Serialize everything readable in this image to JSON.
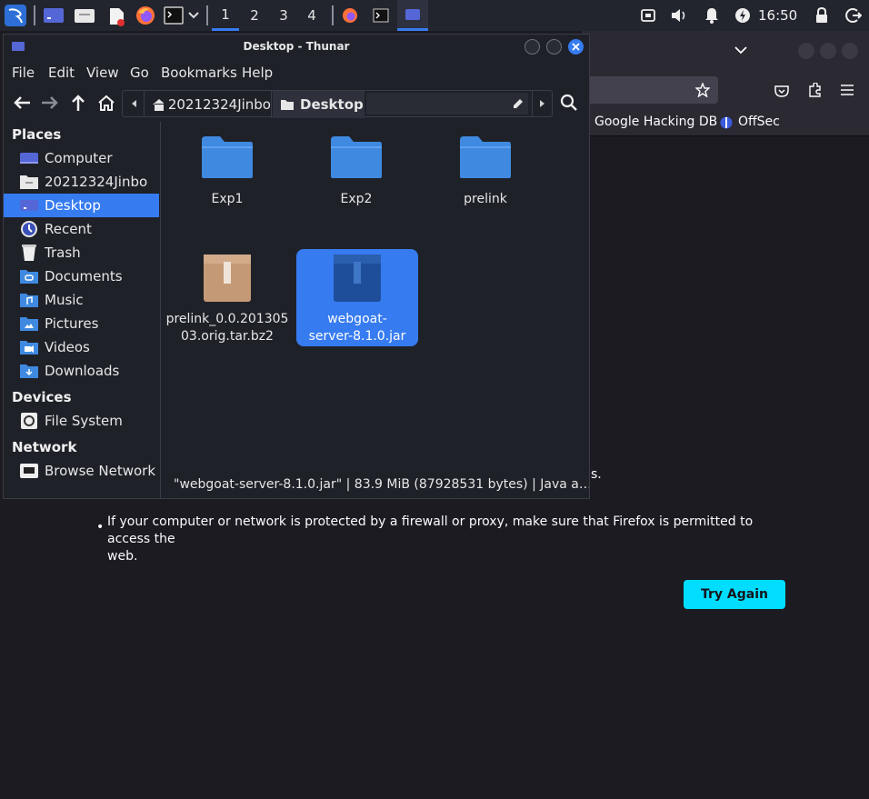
{
  "panel": {
    "workspaces": [
      "1",
      "2",
      "3",
      "4"
    ],
    "clock": "16:50",
    "icons": [
      "kali-menu-icon",
      "desktop-icon",
      "file-manager-icon",
      "text-editor-icon",
      "firefox-icon",
      "terminal-icon",
      "chevron-down-icon",
      "firefox-task-icon",
      "terminal-task-icon",
      "thunar-task-icon",
      "network-icon",
      "volume-icon",
      "notifications-icon",
      "power-icon",
      "lock-icon",
      "logout-icon"
    ]
  },
  "firefox": {
    "bookmarks": [
      "Google Hacking DB",
      "OffSec"
    ],
    "error_lines": [
      "s.",
      "If your computer or network is protected by a firewall or proxy, make sure that Firefox is permitted to access the",
      "web."
    ],
    "try_again_label": "Try Again"
  },
  "thunar": {
    "title": "Desktop - Thunar",
    "menu": [
      "File",
      "Edit",
      "View",
      "Go",
      "Bookmarks",
      "Help"
    ],
    "breadcrumbs": [
      "20212324Jinbo",
      "Desktop"
    ],
    "sidebar": {
      "places_heading": "Places",
      "places": [
        "Computer",
        "20212324Jinbo",
        "Desktop",
        "Recent",
        "Trash",
        "Documents",
        "Music",
        "Pictures",
        "Videos",
        "Downloads"
      ],
      "devices_heading": "Devices",
      "devices": [
        "File System"
      ],
      "network_heading": "Network",
      "network": [
        "Browse Network"
      ]
    },
    "files": [
      {
        "name": "Exp1",
        "type": "folder"
      },
      {
        "name": "Exp2",
        "type": "folder"
      },
      {
        "name": "prelink",
        "type": "folder"
      },
      {
        "name": "prelink_0.0.20130503.orig.tar.bz2",
        "line1": "prelink_0.0.201305",
        "line2": "03.orig.tar.bz2",
        "type": "archive"
      },
      {
        "name": "webgoat-server-8.1.0.jar",
        "line1": "webgoat-",
        "line2": "server-8.1.0.jar",
        "type": "jar",
        "selected": true
      }
    ],
    "status": "\"webgoat-server-8.1.0.jar\" | 83.9 MiB (87928531 bytes) | Java a…"
  },
  "colors": {
    "accent": "#367bf0",
    "folder": "#3f8ae0",
    "try_again": "#00ddff"
  }
}
